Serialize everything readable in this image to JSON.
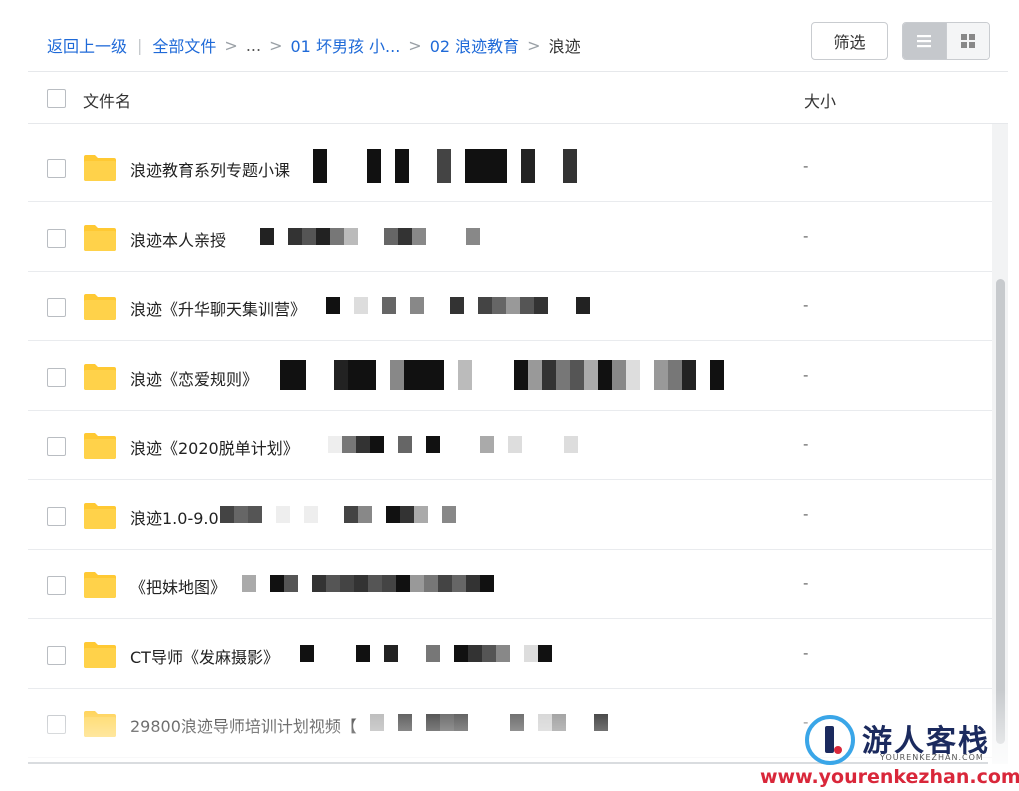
{
  "breadcrumb": {
    "back": "返回上一级",
    "all_files": "全部文件",
    "ellipsis": "...",
    "level1": "01 坏男孩 小...",
    "level2": "02 浪迹教育",
    "current": "浪迹"
  },
  "toolbar": {
    "filter_label": "筛选",
    "view_list_icon": "list-icon",
    "view_grid_icon": "grid-icon"
  },
  "columns": {
    "name": "文件名",
    "size": "大小"
  },
  "files": [
    {
      "name": "浪迹教育系列专题小课",
      "size": "-"
    },
    {
      "name": "浪迹本人亲授",
      "size": "-"
    },
    {
      "name": "浪迹《升华聊天集训营》",
      "size": "-"
    },
    {
      "name": "浪迹《恋爱规则》",
      "size": "-"
    },
    {
      "name": "浪迹《2020脱单计划》",
      "size": "-"
    },
    {
      "name": "浪迹1.0-9.0",
      "size": "-"
    },
    {
      "name": "《把妹地图》",
      "size": "-"
    },
    {
      "name": "CT导师《发麻摄影》",
      "size": "-"
    },
    {
      "name": "29800浪迹导师培训计划视频【",
      "size": "-"
    }
  ],
  "watermark": {
    "title": "游人客栈",
    "subtitle": "YOURENKEZHAN.COM",
    "url": "www.yourenkezhan.com"
  },
  "colors": {
    "link": "#1f6ad8",
    "folder": "#ffc933",
    "watermark_red": "#d9273a",
    "watermark_navy": "#1b2a5e"
  }
}
